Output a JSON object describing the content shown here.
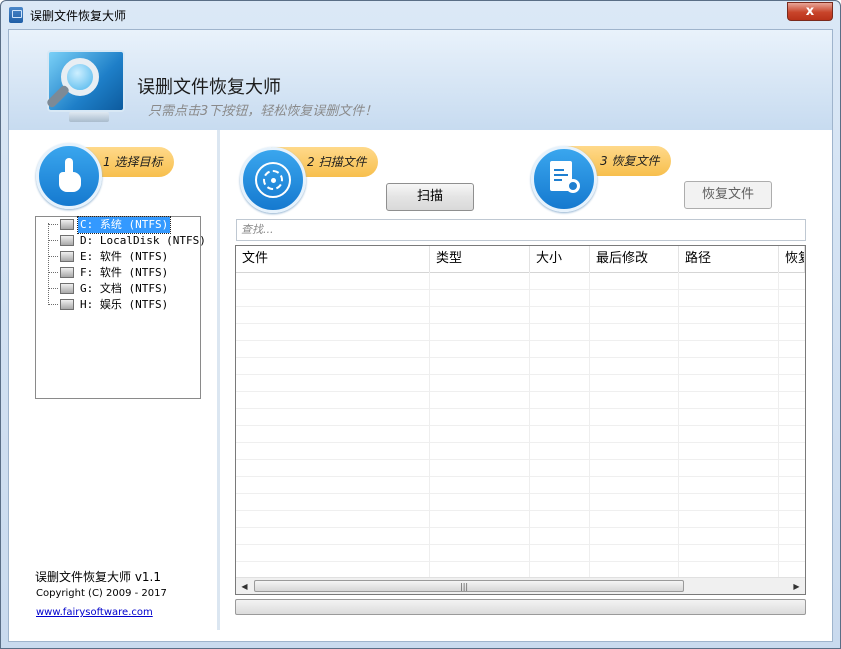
{
  "window": {
    "title": "误删文件恢复大师",
    "close_label": "x"
  },
  "header": {
    "title": "误删文件恢复大师",
    "subtitle": "只需点击3下按钮，轻松恢复误删文件！"
  },
  "steps": [
    {
      "label": "1 选择目标",
      "icon": "hand-pointer-icon"
    },
    {
      "label": "2 扫描文件",
      "icon": "radar-icon"
    },
    {
      "label": "3 恢复文件",
      "icon": "document-search-icon"
    }
  ],
  "buttons": {
    "scan": "扫描",
    "recover": "恢复文件"
  },
  "drives": [
    {
      "label": "C: 系统 (NTFS)",
      "selected": true
    },
    {
      "label": "D: LocalDisk (NTFS)",
      "selected": false
    },
    {
      "label": "E: 软件 (NTFS)",
      "selected": false
    },
    {
      "label": "F: 软件 (NTFS)",
      "selected": false
    },
    {
      "label": "G: 文档 (NTFS)",
      "selected": false
    },
    {
      "label": "H: 娱乐 (NTFS)",
      "selected": false
    }
  ],
  "footer": {
    "version": "误删文件恢复大师 v1.1",
    "copyright": "Copyright (C) 2009 - 2017",
    "website": "www.fairysoftware.com"
  },
  "search": {
    "placeholder": "查找..."
  },
  "table": {
    "columns": [
      "文件",
      "类型",
      "大小",
      "最后修改",
      "路径",
      "恢复"
    ],
    "rows": []
  },
  "progress": {
    "value": 0
  },
  "colors": {
    "accent_blue": "#1579cf",
    "step_badge": "#f7bf4d",
    "selection": "#3399ff"
  }
}
